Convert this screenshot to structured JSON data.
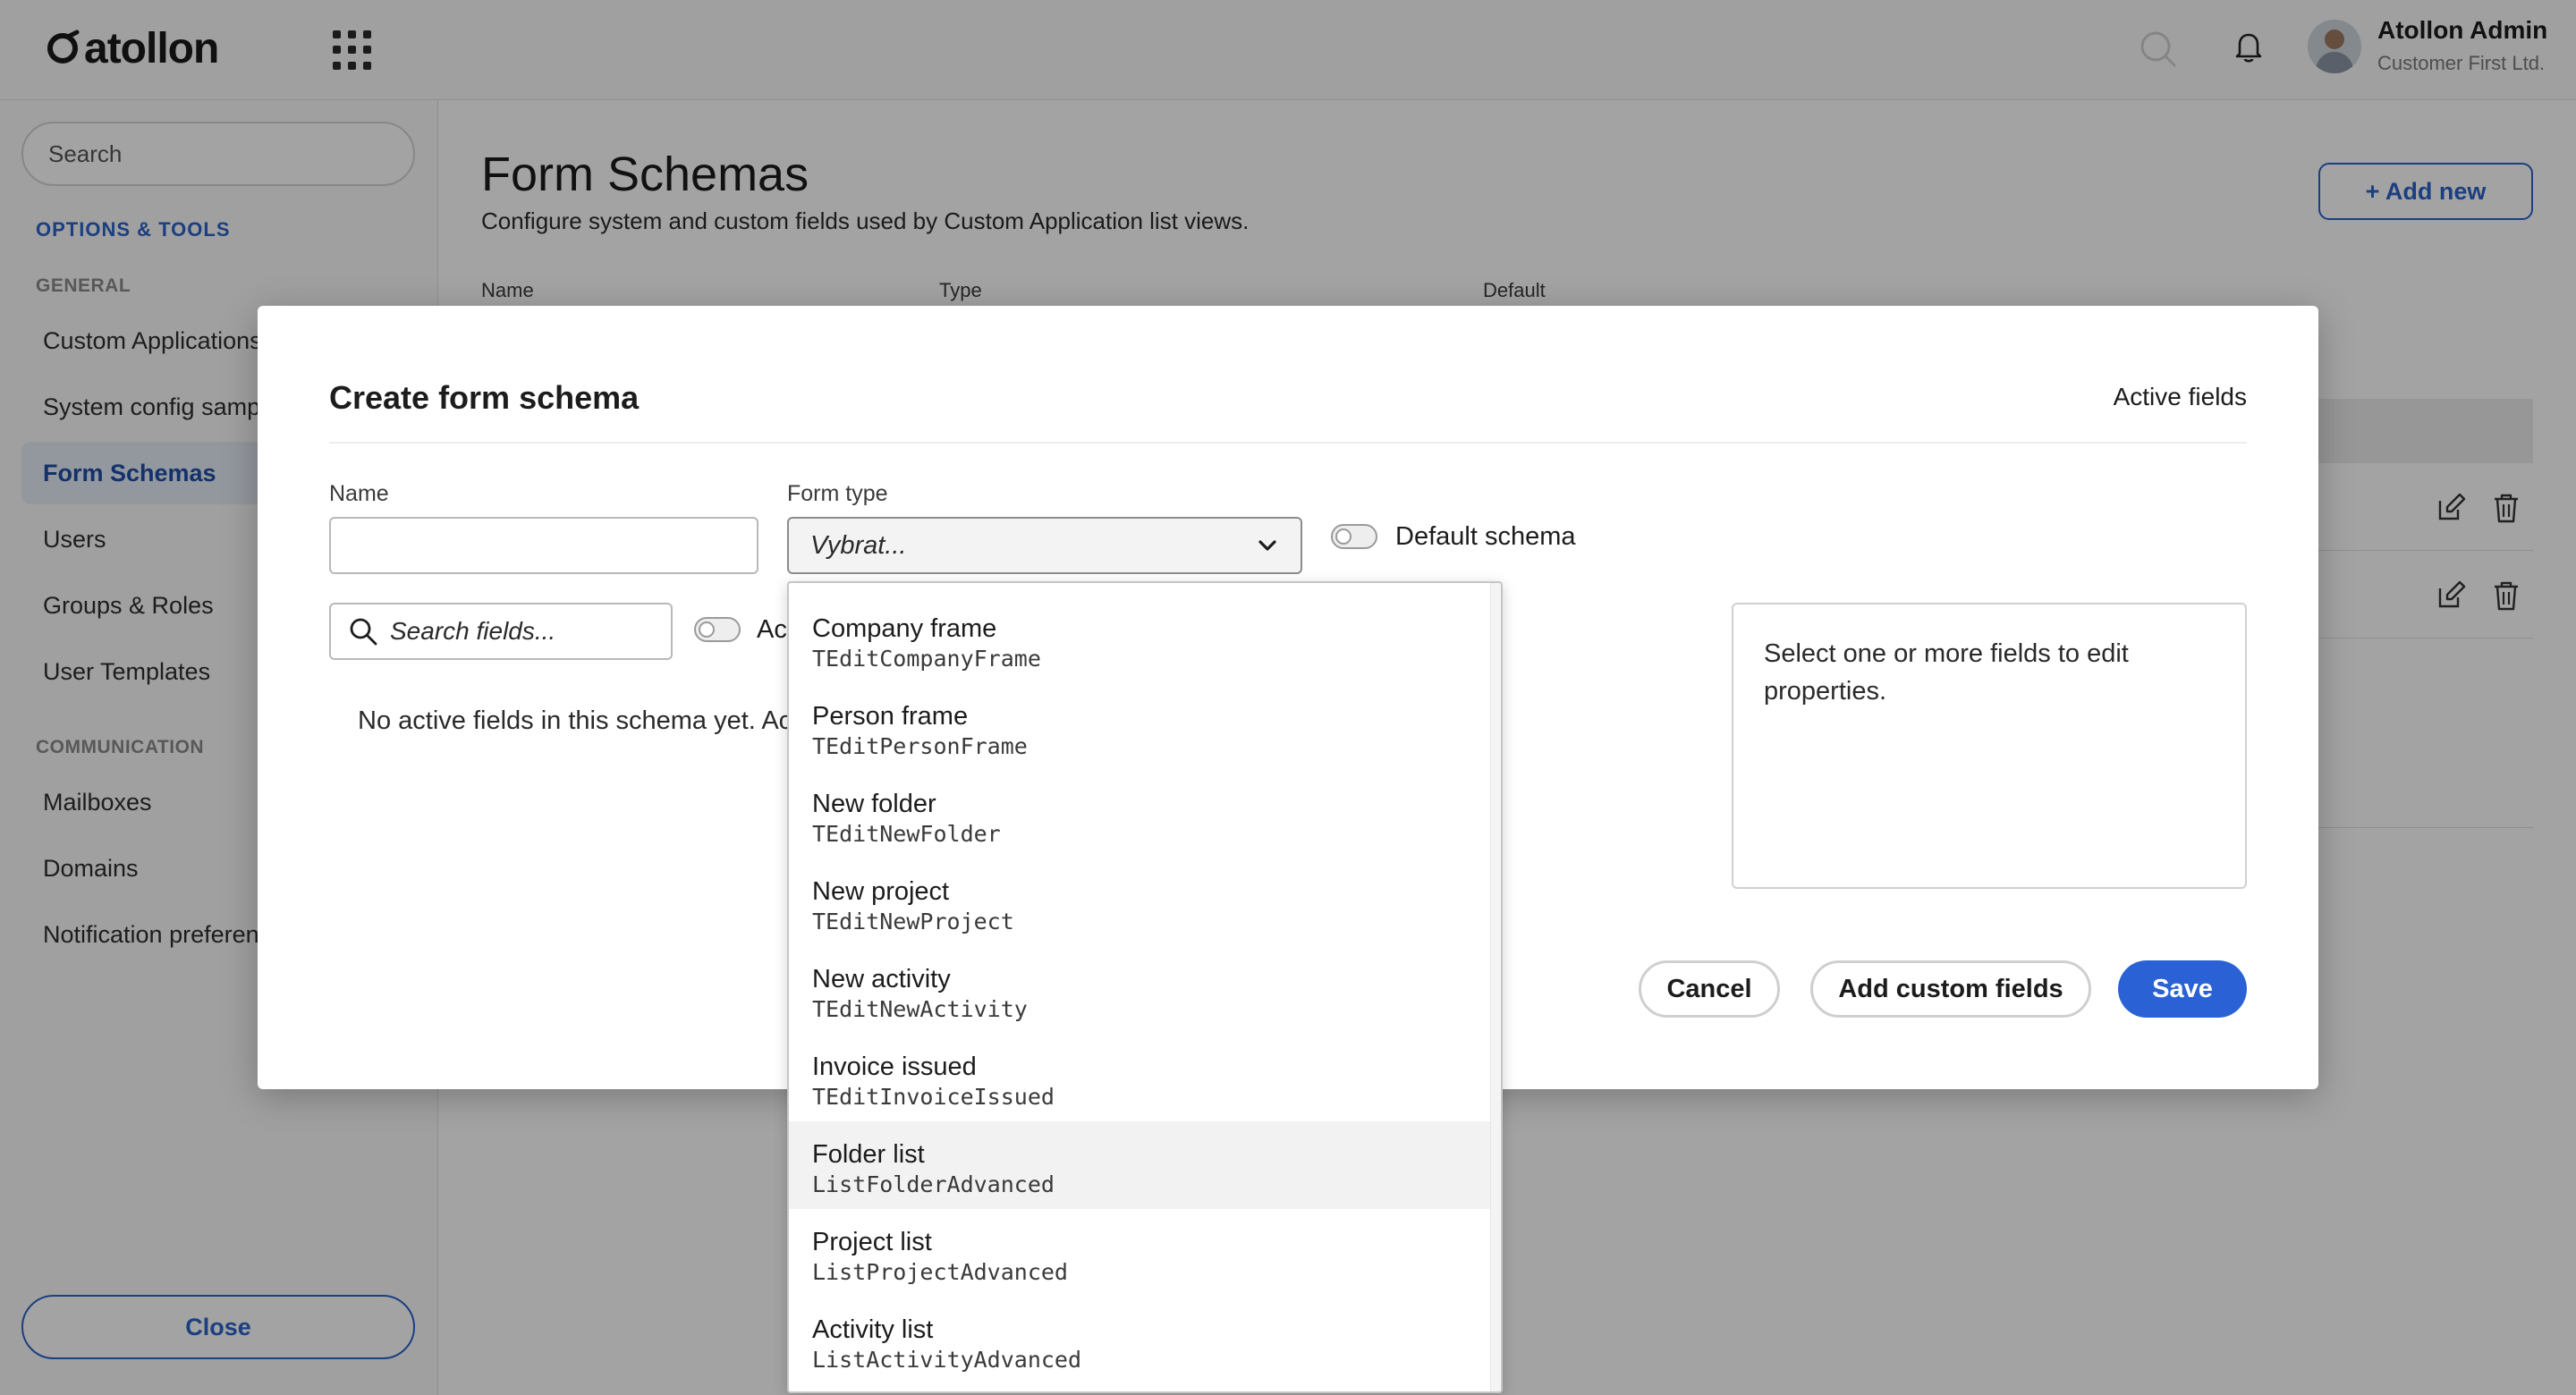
{
  "header": {
    "logo_text": "atollon",
    "user_name": "Atollon Admin",
    "user_company": "Customer First Ltd."
  },
  "sidebar": {
    "search_placeholder": "Search",
    "heading": "OPTIONS & TOOLS",
    "groups": {
      "general": "GENERAL",
      "communication": "COMMUNICATION"
    },
    "general_items": [
      {
        "label": "Custom Applications"
      },
      {
        "label": "System config samples"
      },
      {
        "label": "Form Schemas"
      },
      {
        "label": "Users"
      },
      {
        "label": "Groups & Roles"
      },
      {
        "label": "User Templates"
      }
    ],
    "communication_items": [
      {
        "label": "Mailboxes"
      },
      {
        "label": "Domains"
      },
      {
        "label": "Notification preferences"
      }
    ],
    "close_label": "Close"
  },
  "page": {
    "title": "Form Schemas",
    "subtitle": "Configure system and custom fields used by Custom Application list views.",
    "add_new_label": "+ Add new",
    "columns": [
      "Name",
      "Type",
      "Default"
    ]
  },
  "modal": {
    "title": "Create form schema",
    "right_title": "Active fields",
    "name_label": "Name",
    "name_value": "",
    "form_type_label": "Form type",
    "form_type_value": "Vybrat...",
    "default_schema_label": "Default schema",
    "search_placeholder": "Search fields...",
    "active_toggle_label": "Ac",
    "empty_text": "No active fields in this schema yet. Ac",
    "properties_text": "Select one or more fields to edit properties.",
    "cancel_label": "Cancel",
    "add_custom_label": "Add custom fields",
    "save_label": "Save",
    "accent_color": "#2a62d6"
  },
  "dropdown": {
    "hovered_index": 6,
    "options": [
      {
        "label": "Company frame",
        "code": "TEditCompanyFrame"
      },
      {
        "label": "Person frame",
        "code": "TEditPersonFrame"
      },
      {
        "label": "New folder",
        "code": "TEditNewFolder"
      },
      {
        "label": "New project",
        "code": "TEditNewProject"
      },
      {
        "label": "New activity",
        "code": "TEditNewActivity"
      },
      {
        "label": "Invoice issued",
        "code": "TEditInvoiceIssued"
      },
      {
        "label": "Folder list",
        "code": "ListFolderAdvanced"
      },
      {
        "label": "Project list",
        "code": "ListProjectAdvanced"
      },
      {
        "label": "Activity list",
        "code": "ListActivityAdvanced"
      }
    ]
  }
}
